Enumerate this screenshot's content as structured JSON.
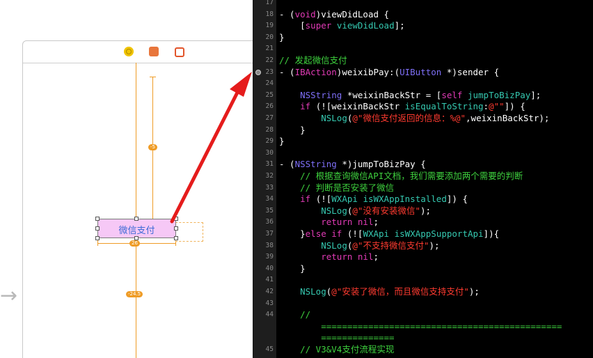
{
  "canvas": {
    "button_label": "微信支付",
    "constraint_top": "-5",
    "constraint_width": "26",
    "constraint_bottom": "-24.5"
  },
  "editor": {
    "lines": [
      {
        "n": "17",
        "segs": []
      },
      {
        "n": "18",
        "segs": [
          [
            "w",
            "- ("
          ],
          [
            "k",
            "void"
          ],
          [
            "w",
            ")viewDidLoad {"
          ]
        ]
      },
      {
        "n": "19",
        "segs": [
          [
            "w",
            "    ["
          ],
          [
            "k",
            "super"
          ],
          [
            "w",
            " "
          ],
          [
            "m",
            "viewDidLoad"
          ],
          [
            "w",
            "];"
          ]
        ]
      },
      {
        "n": "20",
        "segs": [
          [
            "w",
            "}"
          ]
        ]
      },
      {
        "n": "21",
        "segs": []
      },
      {
        "n": "22",
        "segs": [
          [
            "c",
            "// 发起微信支付"
          ]
        ]
      },
      {
        "n": "23",
        "bp": true,
        "segs": [
          [
            "w",
            "- ("
          ],
          [
            "k",
            "IBAction"
          ],
          [
            "w",
            ")weixibPay:("
          ],
          [
            "t",
            "UIButton"
          ],
          [
            "w",
            " *)sender {"
          ]
        ]
      },
      {
        "n": "24",
        "segs": []
      },
      {
        "n": "25",
        "segs": [
          [
            "w",
            "    "
          ],
          [
            "t",
            "NSString"
          ],
          [
            "w",
            " *weixinBackStr = ["
          ],
          [
            "k",
            "self"
          ],
          [
            "w",
            " "
          ],
          [
            "m",
            "jumpToBizPay"
          ],
          [
            "w",
            "];"
          ]
        ]
      },
      {
        "n": "26",
        "segs": [
          [
            "w",
            "    "
          ],
          [
            "k",
            "if"
          ],
          [
            "w",
            " (![weixinBackStr "
          ],
          [
            "m",
            "isEqualToString"
          ],
          [
            "w",
            ":"
          ],
          [
            "s",
            "@\"\""
          ],
          [
            "w",
            "]) {"
          ]
        ]
      },
      {
        "n": "27",
        "segs": [
          [
            "w",
            "        "
          ],
          [
            "m",
            "NSLog"
          ],
          [
            "w",
            "("
          ],
          [
            "s",
            "@\"微信支付返回的信息：%@\""
          ],
          [
            "w",
            ",weixinBackStr);"
          ]
        ]
      },
      {
        "n": "28",
        "segs": [
          [
            "w",
            "    }"
          ]
        ]
      },
      {
        "n": "29",
        "segs": [
          [
            "w",
            "}"
          ]
        ]
      },
      {
        "n": "30",
        "segs": []
      },
      {
        "n": "31",
        "segs": [
          [
            "w",
            "- ("
          ],
          [
            "t",
            "NSString"
          ],
          [
            "w",
            " *)jumpToBizPay {"
          ]
        ]
      },
      {
        "n": "32",
        "segs": [
          [
            "w",
            "    "
          ],
          [
            "c",
            "// 根据查询微信API文档，我们需要添加两个需要的判断"
          ]
        ]
      },
      {
        "n": "33",
        "segs": [
          [
            "w",
            "    "
          ],
          [
            "c",
            "// 判断是否安装了微信"
          ]
        ]
      },
      {
        "n": "34",
        "segs": [
          [
            "w",
            "    "
          ],
          [
            "k",
            "if"
          ],
          [
            "w",
            " (!["
          ],
          [
            "m",
            "WXApi"
          ],
          [
            "w",
            " "
          ],
          [
            "m",
            "isWXAppInstalled"
          ],
          [
            "w",
            "]) {"
          ]
        ]
      },
      {
        "n": "35",
        "segs": [
          [
            "w",
            "        "
          ],
          [
            "m",
            "NSLog"
          ],
          [
            "w",
            "("
          ],
          [
            "s",
            "@\"没有安装微信\""
          ],
          [
            "w",
            ");"
          ]
        ]
      },
      {
        "n": "36",
        "segs": [
          [
            "w",
            "        "
          ],
          [
            "k",
            "return"
          ],
          [
            "w",
            " "
          ],
          [
            "k",
            "nil"
          ],
          [
            "w",
            ";"
          ]
        ]
      },
      {
        "n": "37",
        "segs": [
          [
            "w",
            "    }"
          ],
          [
            "k",
            "else if"
          ],
          [
            "w",
            " (!["
          ],
          [
            "m",
            "WXApi"
          ],
          [
            "w",
            " "
          ],
          [
            "m",
            "isWXAppSupportApi"
          ],
          [
            "w",
            "]){"
          ]
        ]
      },
      {
        "n": "38",
        "segs": [
          [
            "w",
            "        "
          ],
          [
            "m",
            "NSLog"
          ],
          [
            "w",
            "("
          ],
          [
            "s",
            "@\"不支持微信支付\""
          ],
          [
            "w",
            ");"
          ]
        ]
      },
      {
        "n": "39",
        "segs": [
          [
            "w",
            "        "
          ],
          [
            "k",
            "return"
          ],
          [
            "w",
            " "
          ],
          [
            "k",
            "nil"
          ],
          [
            "w",
            ";"
          ]
        ]
      },
      {
        "n": "40",
        "segs": [
          [
            "w",
            "    }"
          ]
        ]
      },
      {
        "n": "41",
        "segs": []
      },
      {
        "n": "42",
        "segs": [
          [
            "w",
            "    "
          ],
          [
            "m",
            "NSLog"
          ],
          [
            "w",
            "("
          ],
          [
            "s",
            "@\"安装了微信，而且微信支持支付\""
          ],
          [
            "w",
            ");"
          ]
        ]
      },
      {
        "n": "43",
        "segs": []
      },
      {
        "n": "44",
        "segs": [
          [
            "w",
            "    "
          ],
          [
            "c",
            "//"
          ]
        ]
      },
      {
        "n": "",
        "segs": [
          [
            "w",
            "        "
          ],
          [
            "c",
            "=============================================="
          ]
        ]
      },
      {
        "n": "",
        "segs": [
          [
            "w",
            "        "
          ],
          [
            "c",
            "=============="
          ]
        ]
      },
      {
        "n": "45",
        "segs": [
          [
            "w",
            "    "
          ],
          [
            "c",
            "// V3&V4支付流程实现"
          ]
        ]
      }
    ]
  },
  "colors": {
    "keyword": "#e13bb6",
    "type": "#7e6ff7",
    "method": "#35c8b0",
    "string": "#ff3b30",
    "comment": "#3ed13e",
    "constraint": "#ef9c26",
    "arrow": "#e51c1c"
  }
}
